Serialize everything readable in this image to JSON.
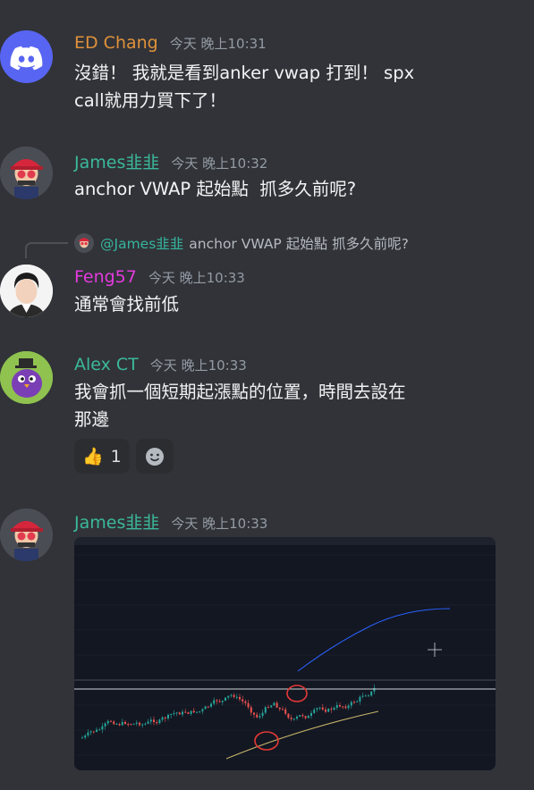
{
  "messages": [
    {
      "author": "ED Chang",
      "author_color": "#e0913b",
      "timestamp": "今天 晚上10:31",
      "text": "沒錯！ 我就是看到anker vwap 打到！ spx\ncall就用力買下了！",
      "avatar_icon": "discord-logo-icon"
    },
    {
      "author": "James韭韭",
      "author_color": "#3bb89a",
      "timestamp": "今天 晚上10:32",
      "text": "anchor VWAP 起始點  抓多久前呢?",
      "avatar_icon": "red-cap-avatar"
    },
    {
      "author": "Feng57",
      "author_color": "#e53adf",
      "timestamp": "今天 晚上10:33",
      "text": "通常會找前低",
      "reply": {
        "mention": "@James韭韭",
        "text": "anchor VWAP 起始點  抓多久前呢?"
      }
    },
    {
      "author": "Alex CT",
      "author_color": "#3bb89a",
      "timestamp": "今天 晚上10:33",
      "text": "我會抓一個短期起漲點的位置，時間去設在\n那邊",
      "reactions": [
        {
          "emoji": "👍",
          "count": "1"
        },
        {
          "emoji": "add-reaction-icon",
          "count": ""
        }
      ]
    },
    {
      "author": "James韭韭",
      "author_color": "#3bb89a",
      "timestamp": "今天 晚上10:33",
      "attachment": "chart-screenshot"
    }
  ]
}
